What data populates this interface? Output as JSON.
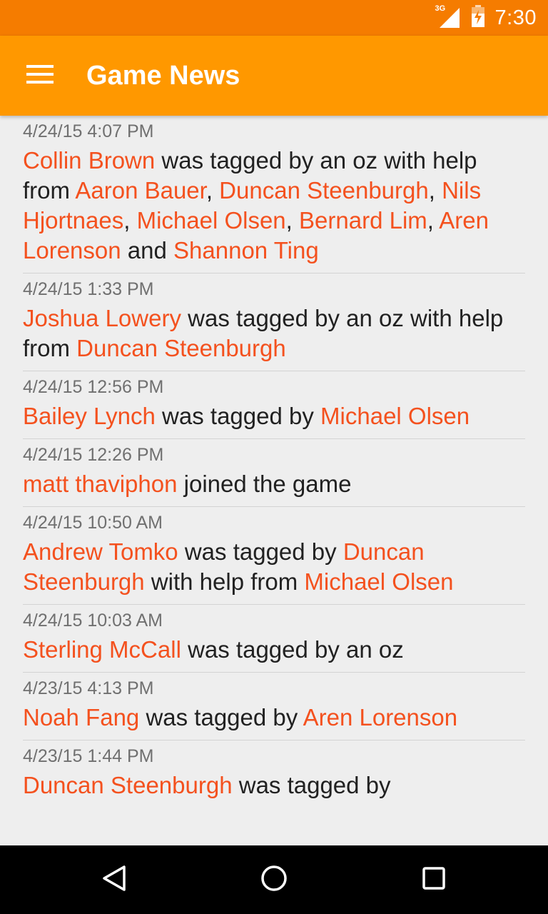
{
  "status_bar": {
    "network": "3G",
    "time": "7:30"
  },
  "app_bar": {
    "title": "Game News",
    "menu_icon": "hamburger-menu-icon"
  },
  "colors": {
    "status_bar": "#f57c00",
    "app_bar": "#ff9800",
    "player_link": "#f4511e",
    "background": "#eeeeee"
  },
  "feed": [
    {
      "timestamp": "4/24/15 4:07 PM",
      "parts": [
        {
          "text": "Collin Brown",
          "player": true
        },
        {
          "text": " was tagged by an oz with help from ",
          "player": false
        },
        {
          "text": "Aaron Bauer",
          "player": true
        },
        {
          "text": ", ",
          "player": false
        },
        {
          "text": "Duncan Steenburgh",
          "player": true
        },
        {
          "text": ", ",
          "player": false
        },
        {
          "text": "Nils Hjortnaes",
          "player": true
        },
        {
          "text": ", ",
          "player": false
        },
        {
          "text": "Michael Olsen",
          "player": true
        },
        {
          "text": ", ",
          "player": false
        },
        {
          "text": "Bernard Lim",
          "player": true
        },
        {
          "text": ", ",
          "player": false
        },
        {
          "text": "Aren Lorenson",
          "player": true
        },
        {
          "text": " and ",
          "player": false
        },
        {
          "text": "Shannon Ting",
          "player": true
        }
      ]
    },
    {
      "timestamp": "4/24/15 1:33 PM",
      "parts": [
        {
          "text": "Joshua Lowery",
          "player": true
        },
        {
          "text": " was tagged by an oz with help from ",
          "player": false
        },
        {
          "text": "Duncan Steenburgh",
          "player": true
        }
      ]
    },
    {
      "timestamp": "4/24/15 12:56 PM",
      "parts": [
        {
          "text": "Bailey Lynch",
          "player": true
        },
        {
          "text": " was tagged by ",
          "player": false
        },
        {
          "text": "Michael Olsen",
          "player": true
        }
      ]
    },
    {
      "timestamp": "4/24/15 12:26 PM",
      "parts": [
        {
          "text": "matt thaviphon",
          "player": true
        },
        {
          "text": " joined the game",
          "player": false
        }
      ]
    },
    {
      "timestamp": "4/24/15 10:50 AM",
      "parts": [
        {
          "text": "Andrew Tomko",
          "player": true
        },
        {
          "text": " was tagged by ",
          "player": false
        },
        {
          "text": "Duncan Steenburgh",
          "player": true
        },
        {
          "text": " with help from ",
          "player": false
        },
        {
          "text": "Michael Olsen",
          "player": true
        }
      ]
    },
    {
      "timestamp": "4/24/15 10:03 AM",
      "parts": [
        {
          "text": "Sterling McCall",
          "player": true
        },
        {
          "text": " was tagged by an oz",
          "player": false
        }
      ]
    },
    {
      "timestamp": "4/23/15 4:13 PM",
      "parts": [
        {
          "text": "Noah Fang",
          "player": true
        },
        {
          "text": " was tagged by ",
          "player": false
        },
        {
          "text": "Aren Lorenson",
          "player": true
        }
      ]
    },
    {
      "timestamp": "4/23/15 1:44 PM",
      "parts": [
        {
          "text": "Duncan Steenburgh",
          "player": true
        },
        {
          "text": " was tagged by",
          "player": false
        }
      ]
    }
  ],
  "nav_bar": {
    "back_icon": "back-triangle-icon",
    "home_icon": "home-circle-icon",
    "recents_icon": "recents-square-icon"
  }
}
